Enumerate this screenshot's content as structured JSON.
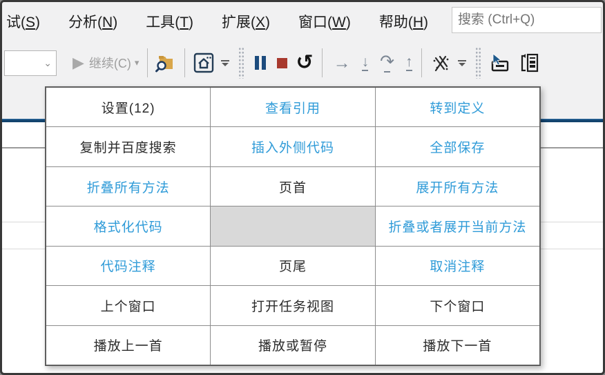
{
  "menu": {
    "items": [
      {
        "label": "试",
        "key": "S"
      },
      {
        "label": "分析",
        "key": "N"
      },
      {
        "label": "工具",
        "key": "T"
      },
      {
        "label": "扩展",
        "key": "X"
      },
      {
        "label": "窗口",
        "key": "W"
      },
      {
        "label": "帮助",
        "key": "H"
      }
    ],
    "search_placeholder": "搜索 (Ctrl+Q)"
  },
  "toolbar": {
    "continue_label": "继续(C)",
    "glyphs": {
      "play": "▶",
      "caret": "▾",
      "combobox_caret": "⌄",
      "restart": "↺",
      "step_over": "→",
      "step_into": "↓",
      "step_out_curve": "↷",
      "step_up": "↑"
    },
    "icon_names": [
      "play-icon",
      "continue-dropdown",
      "search-in-folder-icon",
      "home-icon",
      "pause-icon",
      "stop-icon",
      "restart-icon",
      "step-over-icon",
      "step-into-icon",
      "step-out-icon",
      "step-up-icon",
      "code-analysis-icon",
      "select-element-icon",
      "copy-list-icon"
    ]
  },
  "colors": {
    "accent_link": "#2f9bd8",
    "blue_rule": "#12436d",
    "pause_blue": "#1c4b7d",
    "stop_red": "#a8392e",
    "chrome_bg": "#f1f1f2",
    "empty_cell": "#d9d9d9"
  },
  "grid": {
    "rows": [
      [
        {
          "text": "设置(12)",
          "style": "normal"
        },
        {
          "text": "查看引用",
          "style": "link"
        },
        {
          "text": "转到定义",
          "style": "link"
        }
      ],
      [
        {
          "text": "复制并百度搜索",
          "style": "normal"
        },
        {
          "text": "插入外侧代码",
          "style": "link"
        },
        {
          "text": "全部保存",
          "style": "link"
        }
      ],
      [
        {
          "text": "折叠所有方法",
          "style": "link"
        },
        {
          "text": "页首",
          "style": "normal"
        },
        {
          "text": "展开所有方法",
          "style": "link"
        }
      ],
      [
        {
          "text": "格式化代码",
          "style": "link"
        },
        {
          "text": "",
          "style": "empty"
        },
        {
          "text": "折叠或者展开当前方法",
          "style": "link"
        }
      ],
      [
        {
          "text": "代码注释",
          "style": "link"
        },
        {
          "text": "页尾",
          "style": "normal"
        },
        {
          "text": "取消注释",
          "style": "link"
        }
      ],
      [
        {
          "text": "上个窗口",
          "style": "normal"
        },
        {
          "text": "打开任务视图",
          "style": "normal"
        },
        {
          "text": "下个窗口",
          "style": "normal"
        }
      ],
      [
        {
          "text": "播放上一首",
          "style": "normal"
        },
        {
          "text": "播放或暂停",
          "style": "normal"
        },
        {
          "text": "播放下一首",
          "style": "normal"
        }
      ]
    ]
  }
}
